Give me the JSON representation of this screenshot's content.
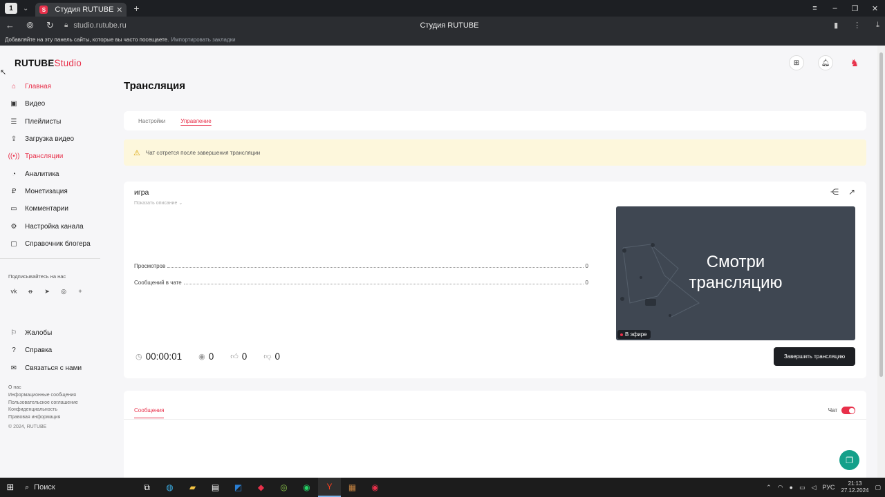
{
  "browser": {
    "workspace_badge": "1",
    "tab_title": "Студия RUTUBE",
    "url": "studio.rutube.ru",
    "page_title": "Студия RUTUBE",
    "bookmarks_hint": "Добавляйте на эту панель сайты, которые вы часто посещаете.",
    "bookmarks_import": "Импортировать закладки"
  },
  "logo": {
    "part1": "RUTUBE",
    "part2": "Studio"
  },
  "sidebar": {
    "items": [
      {
        "label": "Главная",
        "icon": "home-icon",
        "active": true
      },
      {
        "label": "Видео",
        "icon": "video-icon"
      },
      {
        "label": "Плейлисты",
        "icon": "playlist-icon"
      },
      {
        "label": "Загрузка видео",
        "icon": "upload-icon"
      },
      {
        "label": "Трансляции",
        "icon": "broadcast-icon",
        "active": true
      },
      {
        "label": "Аналитика",
        "icon": "analytics-icon"
      },
      {
        "label": "Монетизация",
        "icon": "ruble-icon"
      },
      {
        "label": "Комментарии",
        "icon": "comments-icon"
      },
      {
        "label": "Настройка канала",
        "icon": "gear-icon"
      },
      {
        "label": "Справочник блогера",
        "icon": "guide-icon"
      }
    ],
    "subscribe_label": "Подписывайтесь на нас",
    "secondary": [
      {
        "label": "Жалобы",
        "icon": "flag-icon"
      },
      {
        "label": "Справка",
        "icon": "help-icon"
      },
      {
        "label": "Связаться с нами",
        "icon": "contact-icon"
      }
    ],
    "footer_links": [
      "О нас",
      "Информационные сообщения",
      "Пользовательское соглашение",
      "Конфиденциальность",
      "Правовая информация"
    ],
    "copyright": "© 2024, RUTUBE"
  },
  "page": {
    "title": "Трансляция",
    "tabs": [
      "Настройки",
      "Управление"
    ],
    "active_tab": "Управление",
    "warning": "Чат сотрется после завершения трансляции"
  },
  "stream": {
    "name": "игра",
    "show_description": "Показать описание",
    "stats": [
      {
        "label": "Просмотров",
        "value": "0"
      },
      {
        "label": "Сообщений в чате",
        "value": "0"
      }
    ],
    "duration": "00:00:01",
    "viewers": "0",
    "likes": "0",
    "dislikes": "0",
    "player_text_1": "Смотри",
    "player_text_2": "трансляцию",
    "live_badge": "В эфире",
    "end_button": "Завершить трансляцию"
  },
  "messages": {
    "tab": "Сообщения",
    "chat_label": "Чат",
    "chat_enabled": true
  },
  "taskbar": {
    "search": "Поиск",
    "lang": "РУС",
    "time": "21:13",
    "date": "27.12.2024"
  },
  "colors": {
    "accent": "#e8304a",
    "player_bg": "#3f4752",
    "warning_bg": "#fdf7dc",
    "fab": "#14a08a"
  }
}
